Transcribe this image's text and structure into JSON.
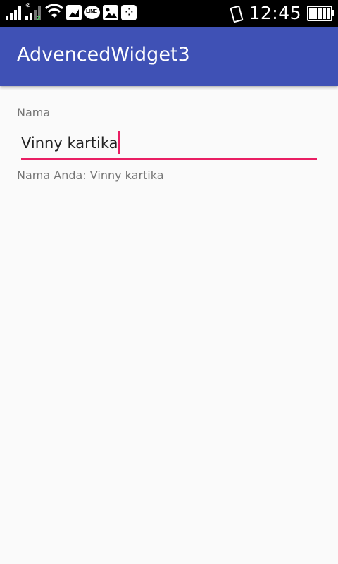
{
  "status_bar": {
    "time": "12:45",
    "signal2_label": "2",
    "signal2_top_label": "⊘",
    "icons": [
      "signal-icon",
      "signal-sim2-icon",
      "wifi-icon",
      "gallery-icon",
      "line-app-icon",
      "image-icon",
      "bbm-icon",
      "vibrate-icon",
      "battery-icon"
    ],
    "battery_level": 1.0
  },
  "app_bar": {
    "title": "AdvencedWidget3",
    "color": "#3f51b5"
  },
  "form": {
    "name_label": "Nama",
    "name_value": "Vinny kartika",
    "result_prefix": "Nama Anda: ",
    "result_text": "Nama Anda: Vinny kartika",
    "accent_color": "#e91e63"
  }
}
